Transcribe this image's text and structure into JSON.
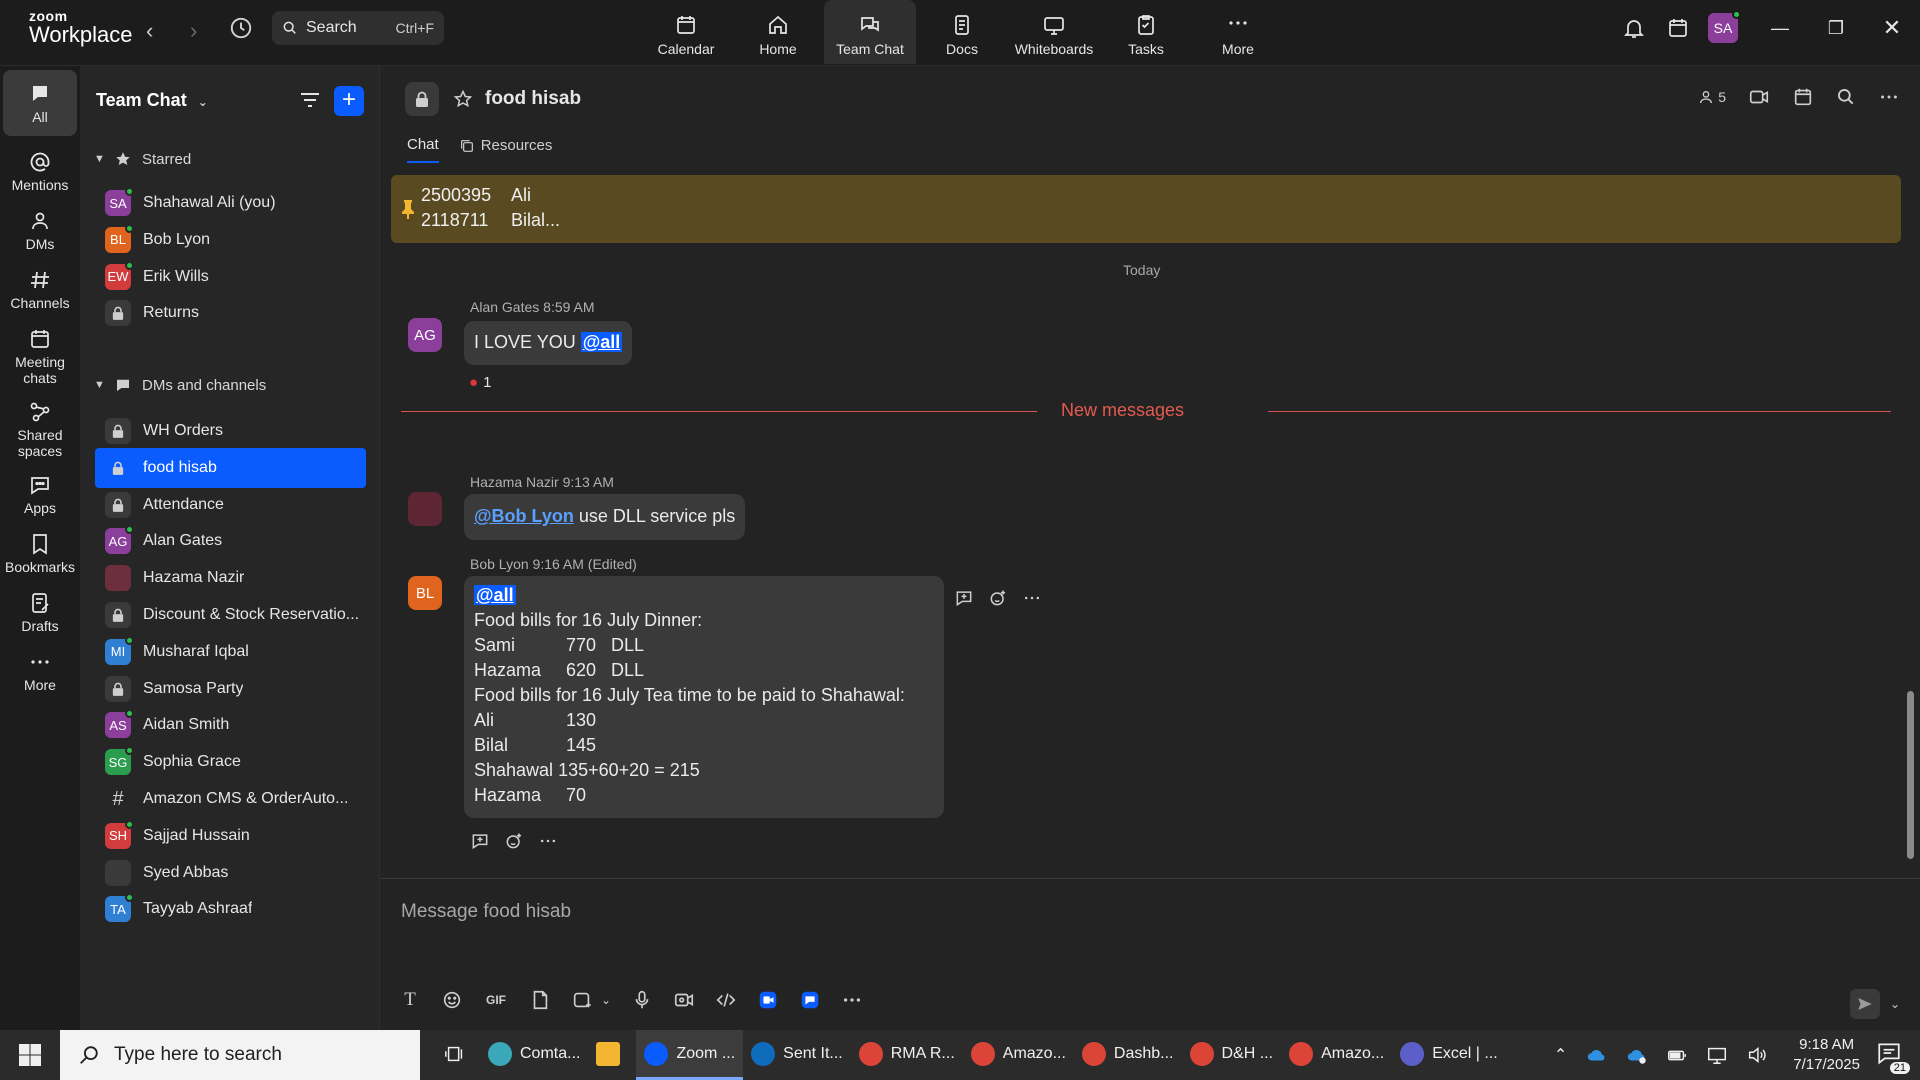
{
  "app": {
    "logo_line1": "zoom",
    "logo_line2": "Workplace",
    "search_label": "Search",
    "search_shortcut": "Ctrl+F",
    "user_initials": "SA"
  },
  "topnav": [
    {
      "label": "Calendar",
      "icon": "calendar-icon"
    },
    {
      "label": "Home",
      "icon": "home-icon"
    },
    {
      "label": "Team Chat",
      "icon": "chat-icon"
    },
    {
      "label": "Docs",
      "icon": "docs-icon"
    },
    {
      "label": "Whiteboards",
      "icon": "whiteboard-icon"
    },
    {
      "label": "Tasks",
      "icon": "tasks-icon"
    },
    {
      "label": "More",
      "icon": "more-icon"
    }
  ],
  "rail": [
    {
      "label": "All"
    },
    {
      "label": "Mentions"
    },
    {
      "label": "DMs"
    },
    {
      "label": "Channels"
    },
    {
      "label": "Meeting chats"
    },
    {
      "label": "Shared spaces"
    },
    {
      "label": "Apps"
    },
    {
      "label": "Bookmarks"
    },
    {
      "label": "Drafts"
    },
    {
      "label": "More"
    }
  ],
  "sidebar": {
    "title": "Team Chat",
    "starred_label": "Starred",
    "dms_label": "DMs and channels",
    "starred": [
      {
        "name": "Shahawal Ali (you)",
        "initials": "SA",
        "color": "#8c3f9a"
      },
      {
        "name": "Bob Lyon",
        "initials": "BL",
        "color": "#e0641e"
      },
      {
        "name": "Erik Wills",
        "initials": "EW",
        "color": "#d23c3c"
      },
      {
        "name": "Returns",
        "initials": "",
        "color": ""
      }
    ],
    "channels": [
      {
        "name": "WH Orders",
        "initials": "",
        "color": ""
      },
      {
        "name": "food hisab",
        "initials": "",
        "color": ""
      },
      {
        "name": "Attendance",
        "initials": "",
        "color": ""
      },
      {
        "name": "Alan Gates",
        "initials": "AG",
        "color": "#8c3f9a"
      },
      {
        "name": "Hazama Nazir",
        "initials": "",
        "color": "#6b2f3d"
      },
      {
        "name": "Discount & Stock Reservatio...",
        "initials": "",
        "color": ""
      },
      {
        "name": "Musharaf Iqbal",
        "initials": "MI",
        "color": "#2f7fd4"
      },
      {
        "name": "Samosa Party",
        "initials": "",
        "color": ""
      },
      {
        "name": "Aidan Smith",
        "initials": "AS",
        "color": "#8c3f9a"
      },
      {
        "name": "Sophia Grace",
        "initials": "SG",
        "color": "#2a9d4f"
      },
      {
        "name": "Amazon CMS & OrderAuto...",
        "initials": "",
        "color": ""
      },
      {
        "name": "Sajjad Hussain",
        "initials": "SH",
        "color": "#d23c3c"
      },
      {
        "name": "Syed Abbas",
        "initials": "",
        "color": "#3a3a3a"
      },
      {
        "name": "Tayyab Ashraaf",
        "initials": "TA",
        "color": "#2f7fd4"
      }
    ]
  },
  "channel": {
    "title": "food hisab",
    "member_count": "5",
    "tab_chat": "Chat",
    "tab_resources": "Resources",
    "pinned": [
      {
        "code": "2500395",
        "name": "Ali"
      },
      {
        "code": "2118711",
        "name": "Bilal..."
      }
    ],
    "today_label": "Today",
    "new_messages_label": "New messages",
    "composer_placeholder": "Message food hisab"
  },
  "messages": {
    "m1": {
      "author": "Alan Gates",
      "time": "8:59 AM",
      "initials": "AG",
      "text": "I LOVE YOU ",
      "mention": "@all",
      "reaction_count": "1"
    },
    "m2": {
      "author": "Hazama Nazir",
      "time": "9:13 AM",
      "mention": "@Bob Lyon",
      "text": " use DLL service pls"
    },
    "m3": {
      "author": "Bob Lyon",
      "time": "9:16 AM",
      "edited": "(Edited)",
      "initials": "BL",
      "mention": "@all",
      "line1": "Food bills for 16 July Dinner:",
      "rows1": [
        {
          "name": "Sami",
          "value": "770   DLL"
        },
        {
          "name": "Hazama",
          "value": "620   DLL"
        }
      ],
      "line2": "Food bills for 16 July Tea time to be paid to Shahawal:",
      "rows2": [
        {
          "name": "Ali",
          "value": "130"
        },
        {
          "name": "Bilal",
          "value": "145"
        },
        {
          "name": "Shahawal",
          "value": "135+60+20 = 215"
        },
        {
          "name": "Hazama",
          "value": "70"
        }
      ]
    }
  },
  "taskbar": {
    "search_placeholder": "Type here to search",
    "apps": [
      {
        "label": "Comta...",
        "color": "#3aa8b8"
      },
      {
        "label": "",
        "color": "#f2b632"
      },
      {
        "label": "Zoom ...",
        "color": "#0b5cff"
      },
      {
        "label": "Sent It...",
        "color": "#0f6cbd"
      },
      {
        "label": "RMA R...",
        "color": "#db4437"
      },
      {
        "label": "Amazo...",
        "color": "#db4437"
      },
      {
        "label": "Dashb...",
        "color": "#db4437"
      },
      {
        "label": "D&H ...",
        "color": "#db4437"
      },
      {
        "label": "Amazo...",
        "color": "#db4437"
      },
      {
        "label": "Excel | ...",
        "color": "#5b5fc7"
      }
    ],
    "time": "9:18 AM",
    "date": "7/17/2025",
    "notifications": "21"
  }
}
